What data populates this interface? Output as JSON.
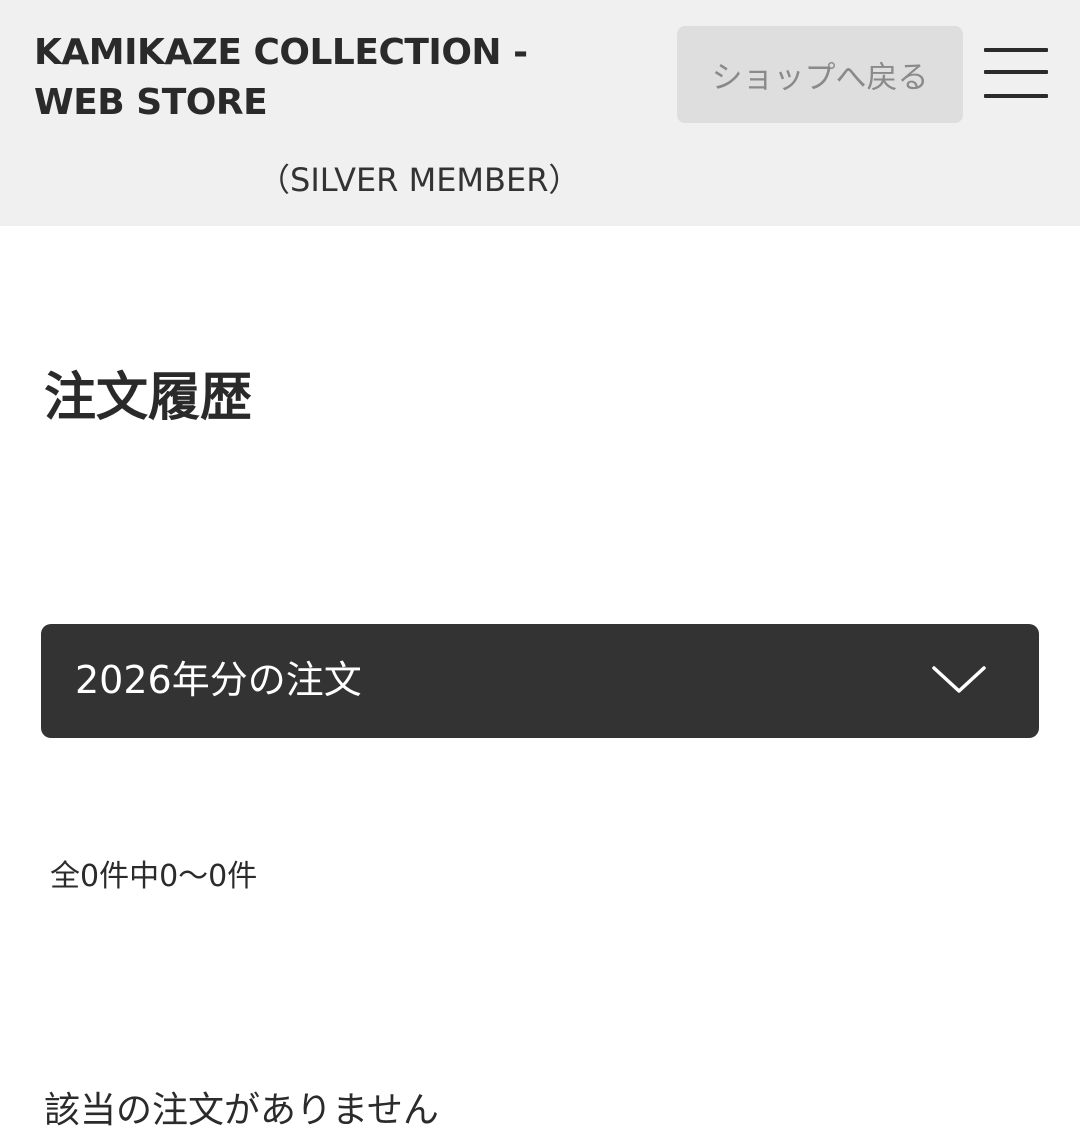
{
  "header": {
    "store_title": "KAMIKAZE COLLECTION - WEB STORE",
    "member_rank": "（SILVER MEMBER）",
    "back_to_shop_label": "ショップへ戻る",
    "menu_icon": "hamburger-menu-icon"
  },
  "main": {
    "page_title": "注文履歴",
    "year_filter": {
      "selected": "2026年分の注文",
      "icon": "chevron-down-icon"
    },
    "result_count": "全0件中0〜0件",
    "empty_message": "該当の注文がありません"
  },
  "colors": {
    "header_bg": "#f0f0f0",
    "button_bg": "#dedede",
    "select_bg": "#333333",
    "text": "#2b2b2b"
  }
}
